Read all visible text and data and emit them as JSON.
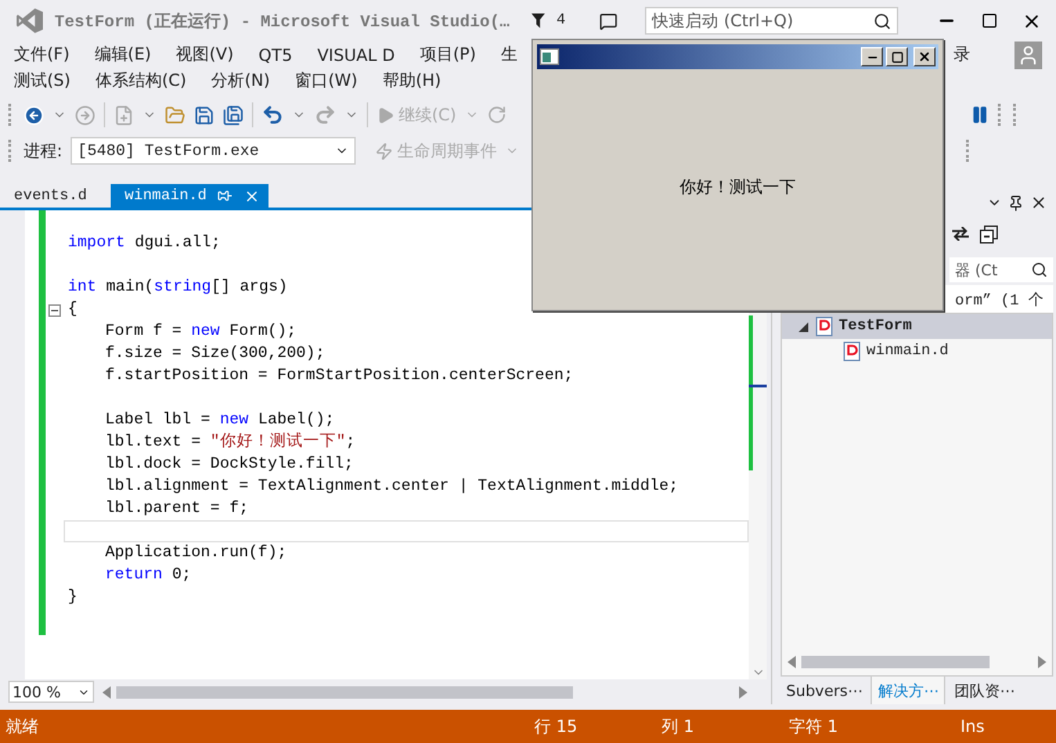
{
  "title_bar": {
    "title": "TestForm (正在运行) - Microsoft Visual Studio(…",
    "notifications": "4",
    "quick_launch": {
      "placeholder": "快速启动 (Ctrl+Q)"
    }
  },
  "menu_row_1": [
    "文件(F)",
    "编辑(E)",
    "视图(V)",
    "QT5",
    "VISUAL D",
    "项目(P)",
    "生"
  ],
  "menu_right": "录",
  "menu_row_2": [
    "测试(S)",
    "体系结构(C)",
    "分析(N)",
    "窗口(W)",
    "帮助(H)"
  ],
  "toolbar": {
    "continue": "继续(C)"
  },
  "debug_bar": {
    "label": "进程:",
    "process": "[5480] TestForm.exe",
    "lifecycle": "生命周期事件"
  },
  "tabs": [
    {
      "label": "events.d",
      "selected": false
    },
    {
      "label": "winmain.d",
      "selected": true
    }
  ],
  "editor": {
    "zoom": "100 %",
    "lines": [
      {
        "current": false,
        "fold": false
      },
      {
        "current": false,
        "fold": false,
        "indented": false,
        "tokens": [
          {
            "kind": "keyword",
            "text": "import"
          },
          {
            "kind": "plain",
            "text": " dgui.all;"
          }
        ]
      },
      {
        "current": false,
        "fold": false
      },
      {
        "current": false,
        "fold": false,
        "indented": false,
        "tokens": [
          {
            "kind": "keyword",
            "text": "int"
          },
          {
            "kind": "plain",
            "text": " main("
          },
          {
            "kind": "keyword",
            "text": "string"
          },
          {
            "kind": "plain",
            "text": "[] args)"
          }
        ]
      },
      {
        "current": false,
        "fold": true,
        "indented": false,
        "tokens": [
          {
            "kind": "plain",
            "text": "{"
          }
        ]
      },
      {
        "current": false,
        "fold": false,
        "indented": true,
        "tokens": [
          {
            "kind": "plain",
            "text": "Form f = "
          },
          {
            "kind": "keyword",
            "text": "new"
          },
          {
            "kind": "plain",
            "text": " Form();"
          }
        ]
      },
      {
        "current": false,
        "fold": false,
        "indented": true,
        "tokens": [
          {
            "kind": "plain",
            "text": "f.size = Size(300,200);"
          }
        ]
      },
      {
        "current": false,
        "fold": false,
        "indented": true,
        "tokens": [
          {
            "kind": "plain",
            "text": "f.startPosition = FormStartPosition.centerScreen;"
          }
        ]
      },
      {
        "current": false,
        "fold": false
      },
      {
        "current": false,
        "fold": false,
        "indented": true,
        "tokens": [
          {
            "kind": "plain",
            "text": "Label lbl = "
          },
          {
            "kind": "keyword",
            "text": "new"
          },
          {
            "kind": "plain",
            "text": " Label();"
          }
        ]
      },
      {
        "current": false,
        "fold": false,
        "indented": true,
        "tokens": [
          {
            "kind": "plain",
            "text": "lbl.text = "
          },
          {
            "kind": "string",
            "text": "\"你好！测试一下\""
          },
          {
            "kind": "plain",
            "text": ";"
          }
        ]
      },
      {
        "current": false,
        "fold": false,
        "indented": true,
        "tokens": [
          {
            "kind": "plain",
            "text": "lbl.dock = DockStyle.fill;"
          }
        ]
      },
      {
        "current": false,
        "fold": false,
        "indented": true,
        "tokens": [
          {
            "kind": "plain",
            "text": "lbl.alignment = TextAlignment.center | TextAlignment.middle;"
          }
        ]
      },
      {
        "current": false,
        "fold": false,
        "indented": true,
        "tokens": [
          {
            "kind": "plain",
            "text": "lbl.parent = f;"
          }
        ]
      },
      {
        "current": true,
        "fold": false
      },
      {
        "current": false,
        "fold": false,
        "indented": true,
        "tokens": [
          {
            "kind": "plain",
            "text": "Application.run(f);"
          }
        ]
      },
      {
        "current": false,
        "fold": false,
        "indented": true,
        "tokens": [
          {
            "kind": "keyword",
            "text": "return"
          },
          {
            "kind": "plain",
            "text": " 0;"
          }
        ]
      },
      {
        "current": false,
        "fold": false,
        "indented": false,
        "tokens": [
          {
            "kind": "plain",
            "text": "}"
          }
        ]
      }
    ]
  },
  "solution_explorer": {
    "search_placeholder": "器 (Ct",
    "info": "orm” (1 个",
    "tree": [
      {
        "label": "TestForm",
        "kind": "project",
        "selected": true,
        "expanded": true,
        "children": [
          {
            "label": "winmain.d",
            "kind": "file",
            "selected": false
          }
        ]
      }
    ],
    "tabs": [
      {
        "label": "Subvers⋯",
        "selected": false
      },
      {
        "label": "解决方⋯",
        "selected": true
      },
      {
        "label": "团队资⋯",
        "selected": false
      }
    ]
  },
  "form_window": {
    "message": "你好！测试一下"
  },
  "status_bar": {
    "state": "就绪",
    "line": "行 15",
    "column": "列 1",
    "char": "字符 1",
    "mode": "Ins"
  }
}
